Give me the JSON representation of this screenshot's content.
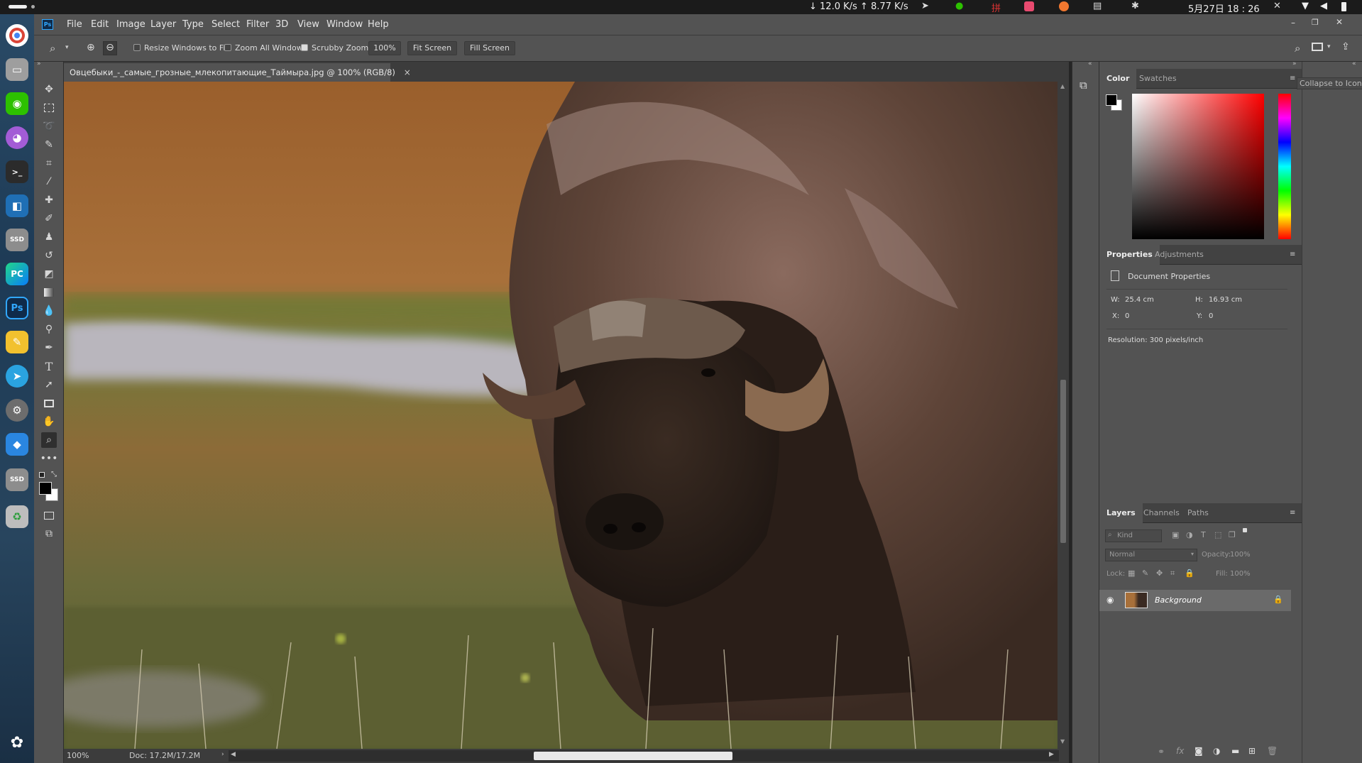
{
  "system": {
    "net_speed": "↓ 12.0 K/s ↑ 8.77 K/s",
    "datetime": "5月27日 18 : 26"
  },
  "dock": {
    "apps": [
      {
        "icon": "chrome-icon",
        "glyph": "●",
        "color": "#e8453c"
      },
      {
        "icon": "files-icon",
        "glyph": "▭",
        "color": "#9e9e9e"
      },
      {
        "icon": "wechat-icon",
        "glyph": "◉",
        "color": "#2dc100"
      },
      {
        "icon": "cat-app-icon",
        "glyph": "◕",
        "color": "#a35cd6"
      },
      {
        "icon": "terminal-icon",
        "glyph": ">_",
        "color": "#2b2b2b"
      },
      {
        "icon": "virtualbox-icon",
        "glyph": "◧",
        "color": "#1f6fb5"
      },
      {
        "icon": "ssd-drive-icon",
        "glyph": "SSD",
        "color": "#8d8d8d"
      },
      {
        "icon": "pycharm-icon",
        "glyph": "PC",
        "color": "#1aa16b"
      },
      {
        "icon": "photoshop-icon",
        "glyph": "Ps",
        "color": "#0f2b4a"
      },
      {
        "icon": "notes-icon",
        "glyph": "✎",
        "color": "#f2c12e"
      },
      {
        "icon": "telegram-icon",
        "glyph": "➤",
        "color": "#2aa3e0"
      },
      {
        "icon": "settings-icon",
        "glyph": "⚙",
        "color": "#6d6d6d"
      },
      {
        "icon": "app-store-icon",
        "glyph": "◆",
        "color": "#2a86e0"
      },
      {
        "icon": "ssd-drive-icon",
        "glyph": "SSD",
        "color": "#8d8d8d"
      },
      {
        "icon": "recycle-icon",
        "glyph": "♻",
        "color": "#bdbdbd"
      }
    ]
  },
  "menu": {
    "app_logo": "Ps",
    "items": [
      "File",
      "Edit",
      "Image",
      "Layer",
      "Type",
      "Select",
      "Filter",
      "3D",
      "View",
      "Window",
      "Help"
    ]
  },
  "options": {
    "resize_windows": "Resize Windows to Fit",
    "zoom_all": "Zoom All Windows",
    "scrubby_zoom": "Scrubby Zoom",
    "zoom_value": "100%",
    "fit_screen": "Fit Screen",
    "fill_screen": "Fill Screen"
  },
  "document": {
    "tab_title": "Овцебыки_-_самые_грозные_млекопитающие_Таймыра.jpg @ 100% (RGB/8)",
    "close": "×",
    "zoom": "100%",
    "doc_size": "Doc: 17.2M/17.2M"
  },
  "tooltip": "Collapse to Icons",
  "color_panel": {
    "tabs": [
      "Color",
      "Swatches"
    ]
  },
  "properties": {
    "tabs": [
      "Properties",
      "Adjustments"
    ],
    "title": "Document Properties",
    "w_label": "W:",
    "w_value": "25.4 cm",
    "h_label": "H:",
    "h_value": "16.93 cm",
    "x_label": "X:",
    "x_value": "0",
    "y_label": "Y:",
    "y_value": "0",
    "resolution": "Resolution: 300 pixels/inch"
  },
  "layers": {
    "tabs": [
      "Layers",
      "Channels",
      "Paths"
    ],
    "kind_placeholder": "Kind",
    "blend_mode": "Normal",
    "opacity_label": "Opacity:",
    "opacity_value": "100%",
    "lock_label": "Lock:",
    "fill_label": "Fill:",
    "fill_value": "100%",
    "rows": [
      {
        "name": "Background"
      }
    ]
  }
}
